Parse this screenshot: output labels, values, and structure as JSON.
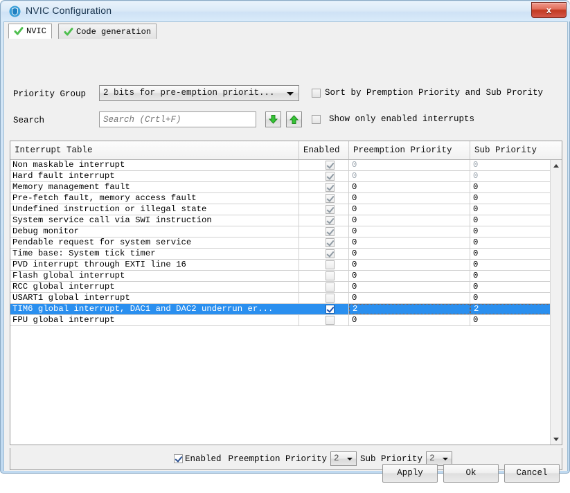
{
  "window": {
    "title": "NVIC Configuration",
    "icon": "shield-icon",
    "close_label": "x"
  },
  "tabs": [
    {
      "label": "NVIC",
      "active": true,
      "icon": "green-check-icon"
    },
    {
      "label": "Code generation",
      "active": false,
      "icon": "green-check-icon"
    }
  ],
  "form": {
    "priority_group_label": "Priority Group",
    "priority_group_value": "2 bits for pre-emption priorit...",
    "search_label": "Search",
    "search_value": "",
    "search_placeholder": "Search (Crtl+F)",
    "search_down_icon": "arrow-down-icon",
    "search_up_icon": "arrow-up-icon",
    "sort_checkbox_label": "Sort by Premption Priority and Sub Prority",
    "sort_checkbox_checked": false,
    "show_enabled_label": "Show only enabled interrupts",
    "show_enabled_checked": false
  },
  "table": {
    "columns": [
      "Interrupt Table",
      "Enabled",
      "Preemption Priority",
      "Sub Priority"
    ],
    "rows": [
      {
        "name": "Non maskable interrupt",
        "enabled": true,
        "locked": true,
        "preemption": "0",
        "sub": "0",
        "dim": true,
        "selected": false
      },
      {
        "name": "Hard fault interrupt",
        "enabled": true,
        "locked": true,
        "preemption": "0",
        "sub": "0",
        "dim": true,
        "selected": false
      },
      {
        "name": "Memory management fault",
        "enabled": true,
        "locked": true,
        "preemption": "0",
        "sub": "0",
        "dim": false,
        "selected": false
      },
      {
        "name": "Pre-fetch fault, memory access fault",
        "enabled": true,
        "locked": true,
        "preemption": "0",
        "sub": "0",
        "dim": false,
        "selected": false
      },
      {
        "name": "Undefined instruction or illegal state",
        "enabled": true,
        "locked": true,
        "preemption": "0",
        "sub": "0",
        "dim": false,
        "selected": false
      },
      {
        "name": "System service call via SWI instruction",
        "enabled": true,
        "locked": true,
        "preemption": "0",
        "sub": "0",
        "dim": false,
        "selected": false
      },
      {
        "name": "Debug monitor",
        "enabled": true,
        "locked": true,
        "preemption": "0",
        "sub": "0",
        "dim": false,
        "selected": false
      },
      {
        "name": "Pendable request for system service",
        "enabled": true,
        "locked": true,
        "preemption": "0",
        "sub": "0",
        "dim": false,
        "selected": false
      },
      {
        "name": "Time base: System tick timer",
        "enabled": true,
        "locked": true,
        "preemption": "0",
        "sub": "0",
        "dim": false,
        "selected": false
      },
      {
        "name": "PVD interrupt through EXTI line 16",
        "enabled": false,
        "locked": false,
        "preemption": "0",
        "sub": "0",
        "dim": false,
        "selected": false
      },
      {
        "name": "Flash global interrupt",
        "enabled": false,
        "locked": false,
        "preemption": "0",
        "sub": "0",
        "dim": false,
        "selected": false
      },
      {
        "name": "RCC global interrupt",
        "enabled": false,
        "locked": false,
        "preemption": "0",
        "sub": "0",
        "dim": false,
        "selected": false
      },
      {
        "name": "USART1 global interrupt",
        "enabled": false,
        "locked": false,
        "preemption": "0",
        "sub": "0",
        "dim": false,
        "selected": false
      },
      {
        "name": "TIM6 global interrupt, DAC1 and DAC2 underrun er...",
        "enabled": true,
        "locked": false,
        "preemption": "2",
        "sub": "2",
        "dim": false,
        "selected": true
      },
      {
        "name": "FPU global interrupt",
        "enabled": false,
        "locked": false,
        "preemption": "0",
        "sub": "0",
        "dim": false,
        "selected": false
      }
    ],
    "scrollbar_up_icon": "triangle-up-icon",
    "scrollbar_down_icon": "triangle-down-icon"
  },
  "properties": {
    "enabled_label": "Enabled",
    "enabled_checked": true,
    "preemption_label": "Preemption Priority",
    "preemption_value": "2",
    "sub_label": "Sub Priority",
    "sub_value": "2"
  },
  "buttons": {
    "apply": "Apply",
    "ok": "Ok",
    "cancel": "Cancel"
  },
  "colors": {
    "selection": "#2a8fef",
    "accent_green": "#3fb43f",
    "close_red": "#c23a22"
  }
}
